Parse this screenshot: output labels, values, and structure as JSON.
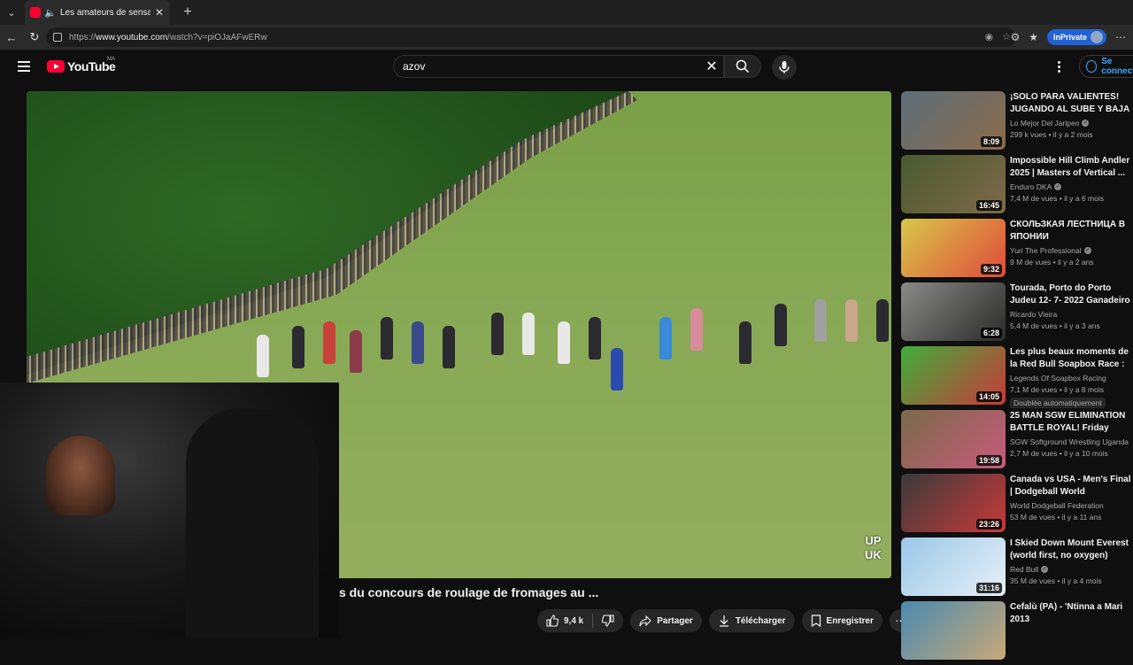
{
  "browser": {
    "tab_title": "Les amateurs de sensations fortes...",
    "url_prefix": "https://",
    "url_host": "www.youtube.com",
    "url_path": "/watch?v=piOJaAFwERw",
    "inprivate_label": "InPrivate"
  },
  "header": {
    "logo_text": "YouTube",
    "country_code": "MA",
    "search_value": "azov",
    "signin_label": "Se connecter"
  },
  "video": {
    "overlay_text_1": "UP",
    "overlay_text_2": "UK",
    "title": "s du concours de roulage de fromages au ..."
  },
  "actions": {
    "like_count": "9,4 k",
    "share_label": "Partager",
    "download_label": "Télécharger",
    "save_label": "Enregistrer"
  },
  "recommendations": [
    {
      "title": "¡SOLO PARA VALIENTES! JUGANDO AL SUBE Y BAJA ...",
      "channel": "Lo Mejor Del Jaripeo",
      "verified": true,
      "meta": "299 k vues • il y a 2 mois",
      "duration": "8:09",
      "thumb_color": "#5d6e7a",
      "thumb_color2": "#8b6b4a"
    },
    {
      "title": "Impossible Hill Climb Andler 2025 | Masters of Vertical ...",
      "channel": "Enduro DKA",
      "verified": true,
      "meta": "7,4 M de vues • il y a 6 mois",
      "duration": "16:45",
      "thumb_color": "#4a5a2e",
      "thumb_color2": "#7e6a4a"
    },
    {
      "title": "СКОЛЬЗКАЯ ЛЕСТНИЦА В ЯПОНИИ",
      "channel": "Yuri The Professional",
      "verified": true,
      "meta": "9 M de vues • il y a 2 ans",
      "duration": "9:32",
      "thumb_color": "#d7c84a",
      "thumb_color2": "#e04a3a"
    },
    {
      "title": "Tourada, Porto do Porto Judeu 12- 7- 2022 Ganadeiro F.P.",
      "channel": "Ricardo Vieira",
      "verified": false,
      "meta": "5,4 M de vues • il y a 3 ans",
      "duration": "6:28",
      "thumb_color": "#8a8a88",
      "thumb_color2": "#2a2a2a"
    },
    {
      "title": "Les plus beaux moments de la Red Bull Soapbox Race : Paris ...",
      "channel": "Legends Of Soapbox Racing",
      "verified": false,
      "meta": "7,1 M de vues • il y a 8 mois",
      "badge": "Doublée automatiquement",
      "duration": "14:05",
      "thumb_color": "#3fae3a",
      "thumb_color2": "#c83a3a"
    },
    {
      "title": "25 MAN SGW ELIMINATION BATTLE ROYAL! Friday amazo...",
      "channel": "SGW Softground Wrestling Uganda",
      "verified": false,
      "meta": "2,7 M de vues • il y a 10 mois",
      "duration": "19:58",
      "thumb_color": "#7a6a4a",
      "thumb_color2": "#c85a7a"
    },
    {
      "title": "Canada vs USA - Men's Final | Dodgeball World Championshi...",
      "channel": "World Dodgeball Federation",
      "verified": false,
      "meta": "53 M de vues • il y a 11 ans",
      "duration": "23:26",
      "thumb_color": "#3a3a3a",
      "thumb_color2": "#c83a3a"
    },
    {
      "title": "I Skied Down Mount Everest (world first, no oxygen)",
      "channel": "Red Bull",
      "verified": true,
      "meta": "35 M de vues • il y a 4 mois",
      "duration": "31:16",
      "thumb_color": "#9ac8e8",
      "thumb_color2": "#e8f0f8"
    },
    {
      "title": "Cefalù (PA) - 'Ntinna a Mari 2013",
      "channel": "",
      "verified": false,
      "meta": "",
      "duration": "",
      "thumb_color": "#4a8ab0",
      "thumb_color2": "#c8a878"
    }
  ]
}
